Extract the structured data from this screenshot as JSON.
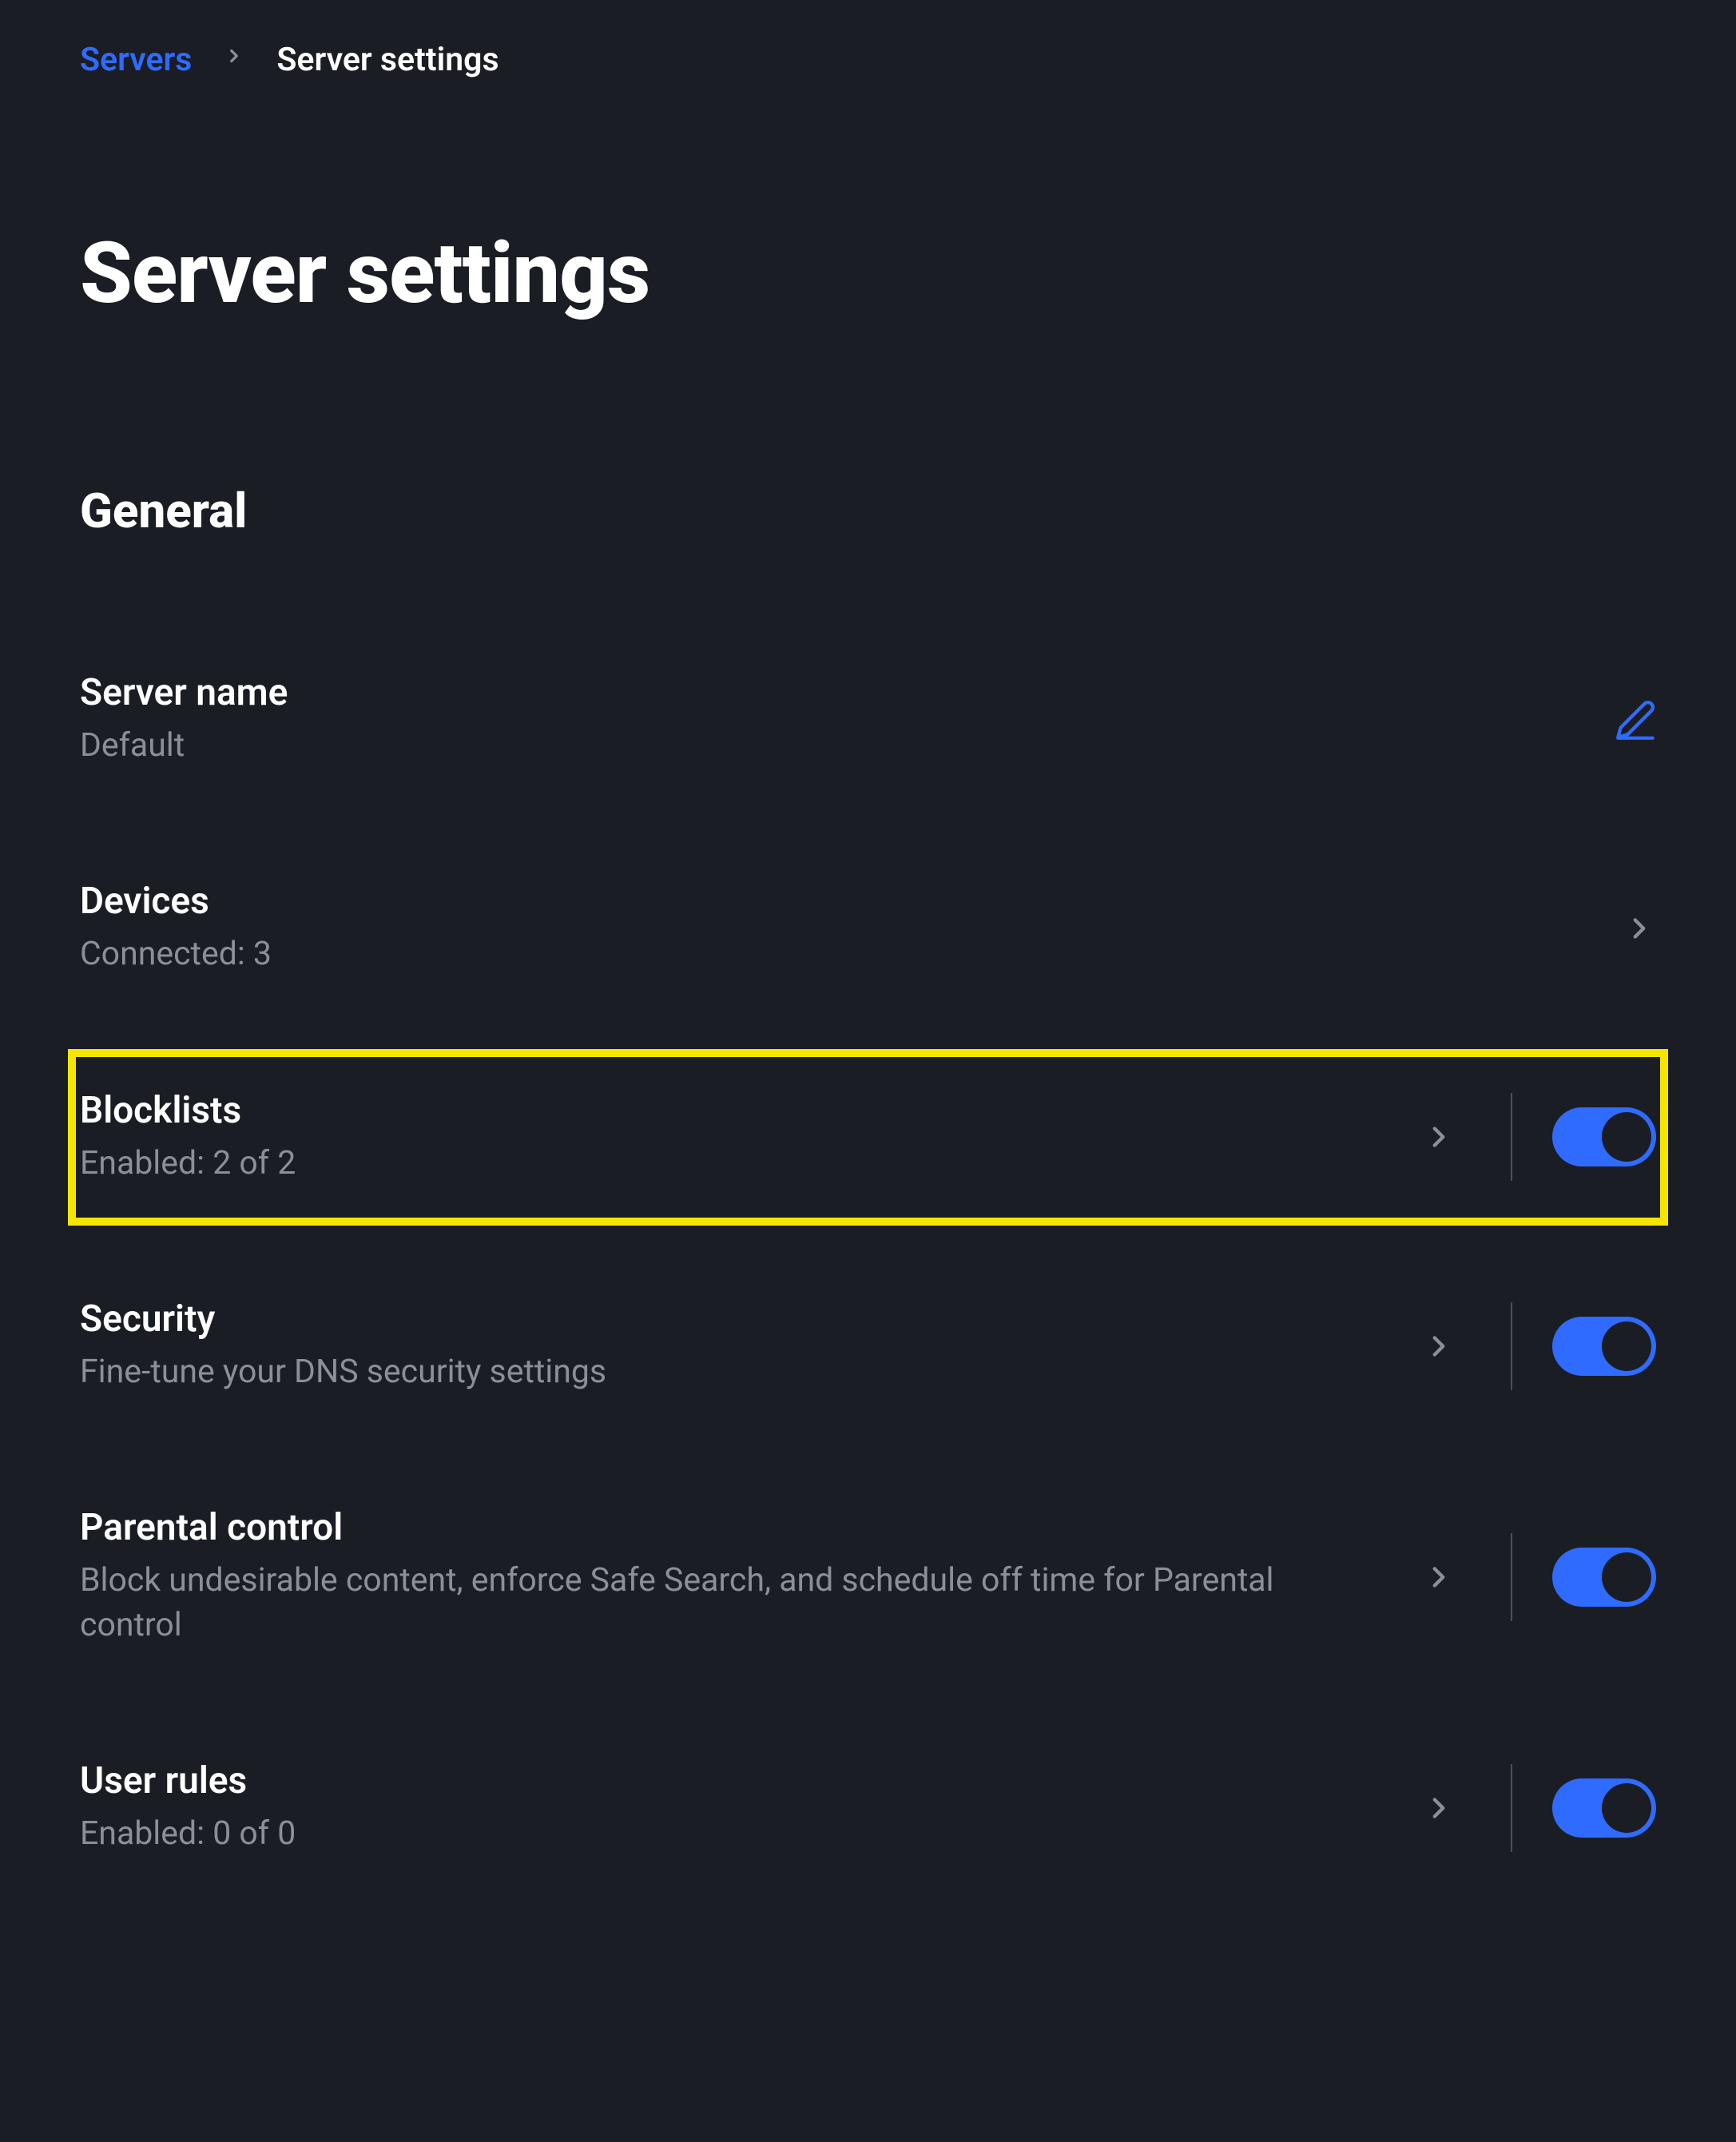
{
  "breadcrumb": {
    "parent": "Servers",
    "current": "Server settings"
  },
  "page_title": "Server settings",
  "section_title": "General",
  "rows": {
    "server_name": {
      "title": "Server name",
      "value": "Default"
    },
    "devices": {
      "title": "Devices",
      "value": "Connected: 3"
    },
    "blocklists": {
      "title": "Blocklists",
      "value": "Enabled: 2 of 2"
    },
    "security": {
      "title": "Security",
      "value": "Fine-tune your DNS security settings"
    },
    "parental": {
      "title": "Parental control",
      "value": "Block undesirable content, enforce Safe Search, and schedule off time for Parental control"
    },
    "user_rules": {
      "title": "User rules",
      "value": "Enabled: 0 of 0"
    }
  }
}
